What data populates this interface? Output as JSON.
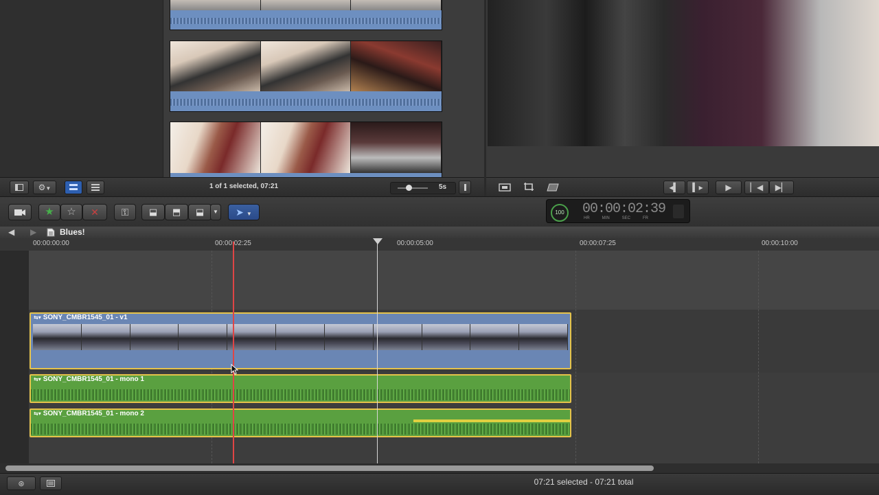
{
  "browser": {
    "selection_status": "1 of 1 selected, 07:21",
    "zoom_label": "5s"
  },
  "toolbar": {
    "timecode_display": "00:00:02:39",
    "timecode_percent": "100",
    "timecode_units": [
      "HR",
      "MIN",
      "SEC",
      "FR"
    ]
  },
  "timeline": {
    "project_name": "Blues!",
    "ruler_ticks": [
      "00:00:00:00",
      "00:00:02:25",
      "00:00:05:00",
      "00:00:07:25",
      "00:00:10:00"
    ],
    "clips": {
      "video": "SONY_CMBR1545_01 - v1",
      "audio1": "SONY_CMBR1545_01 - mono 1",
      "audio2": "SONY_CMBR1545_01 - mono 2"
    }
  },
  "status": {
    "selection_total": "07:21 selected - 07:21 total"
  },
  "colors": {
    "clip_selection": "#e6c34a",
    "video_clip": "#6a86b4",
    "audio_clip": "#5aa040",
    "skimmer": "#e04545"
  }
}
